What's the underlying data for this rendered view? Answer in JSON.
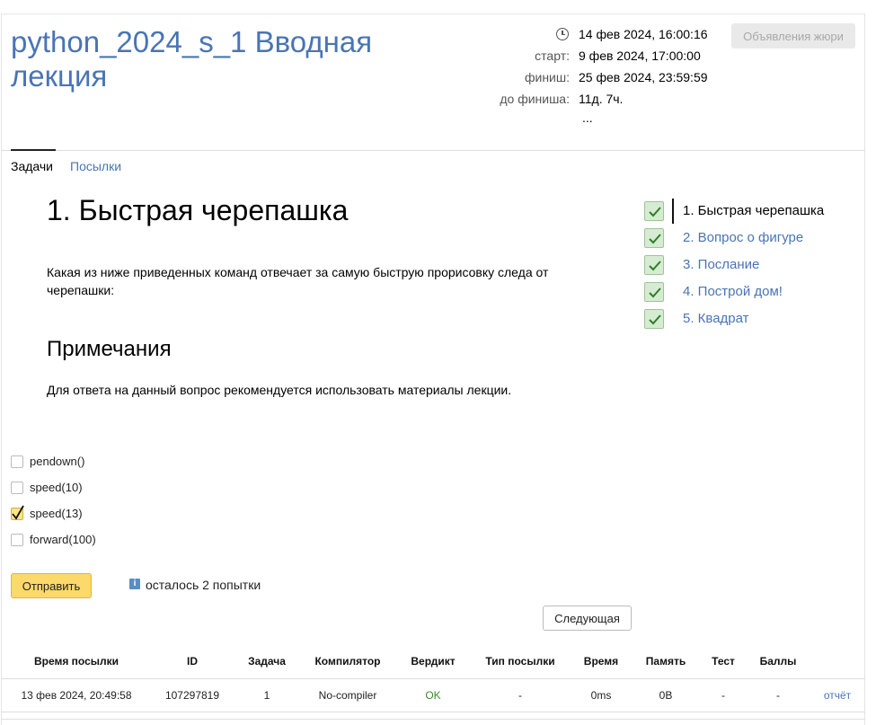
{
  "contest": {
    "title": "python_2024_s_1 Вводная лекция",
    "current_time": "14 фев 2024, 16:00:16",
    "start_label": "старт:",
    "start_value": "9 фев 2024, 17:00:00",
    "finish_label": "финиш:",
    "finish_value": "25 фев 2024, 23:59:59",
    "remaining_label": "до финиша:",
    "remaining_value": "11д. 7ч.",
    "more": "...",
    "jury_button": "Объявления жюри"
  },
  "tabs": [
    {
      "label": "Задачи",
      "active": true
    },
    {
      "label": "Посылки",
      "active": false
    }
  ],
  "problem": {
    "title": "1. Быстрая черепашка",
    "statement": "Какая из ниже приведенных команд отвечает за самую быструю прорисовку следа от черепашки:",
    "notes_title": "Примечания",
    "notes_text": "Для ответа на данный вопрос рекомендуется использовать материалы лекции."
  },
  "task_nav": [
    {
      "label": "1. Быстрая черепашка",
      "solved": true,
      "current": true
    },
    {
      "label": "2. Вопрос о фигуре",
      "solved": true,
      "current": false
    },
    {
      "label": "3. Послание",
      "solved": true,
      "current": false
    },
    {
      "label": "4. Построй дом!",
      "solved": true,
      "current": false
    },
    {
      "label": "5. Квадрат",
      "solved": true,
      "current": false
    }
  ],
  "options": [
    {
      "label": "pendown()",
      "checked": false
    },
    {
      "label": "speed(10)",
      "checked": false
    },
    {
      "label": "speed(13)",
      "checked": true
    },
    {
      "label": "forward(100)",
      "checked": false
    }
  ],
  "submit_button": "Отправить",
  "attempts_text": "осталось 2 попытки",
  "next_button": "Следующая",
  "submissions": {
    "headers": [
      "Время посылки",
      "ID",
      "Задача",
      "Компилятор",
      "Вердикт",
      "Тип посылки",
      "Время",
      "Память",
      "Тест",
      "Баллы"
    ],
    "rows": [
      {
        "time": "13 фев 2024, 20:49:58",
        "id": "107297819",
        "task": "1",
        "compiler": "No-compiler",
        "verdict": "OK",
        "type": "-",
        "exec_time": "0ms",
        "memory": "0B",
        "test": "-",
        "score": "-",
        "report": "отчёт"
      }
    ]
  },
  "colors": {
    "link": "#4a74b4",
    "ok": "#3c8a2e",
    "submit": "#fbd96a",
    "solved_bg": "#d6ecd2"
  }
}
